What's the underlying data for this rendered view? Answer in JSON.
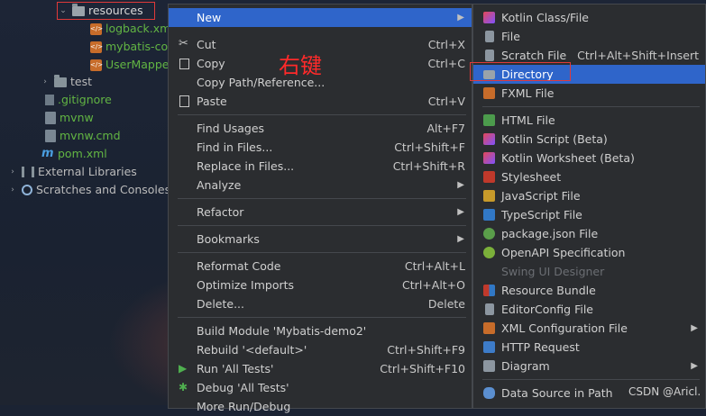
{
  "tree": {
    "items": [
      {
        "label": "resources",
        "kind": "folder-res",
        "arrow": "⌄",
        "color": "#d0d0d0"
      },
      {
        "label": "logback.xm",
        "kind": "xml",
        "color": "#62b543"
      },
      {
        "label": "mybatis-cor",
        "kind": "xml",
        "color": "#62b543"
      },
      {
        "label": "UserMappe",
        "kind": "xml",
        "color": "#62b543"
      },
      {
        "label": "test",
        "kind": "folder",
        "arrow": "›",
        "color": "#bbbbbb"
      },
      {
        "label": ".gitignore",
        "kind": "git",
        "color": "#62b543"
      },
      {
        "label": "mvnw",
        "kind": "file",
        "color": "#62b543"
      },
      {
        "label": "mvnw.cmd",
        "kind": "file",
        "color": "#62b543"
      },
      {
        "label": "pom.xml",
        "kind": "mvn",
        "color": "#62b543"
      },
      {
        "label": "External Libraries",
        "kind": "lib",
        "arrow": "›",
        "color": "#bbbbbb"
      },
      {
        "label": "Scratches and Consoles",
        "kind": "scr",
        "arrow": "›",
        "color": "#bbbbbb"
      }
    ]
  },
  "annotation": "右键",
  "main_menu": {
    "new": "New",
    "cut": "Cut",
    "cut_sc": "Ctrl+X",
    "copy": "Copy",
    "copy_sc": "Ctrl+C",
    "copy_path": "Copy Path/Reference...",
    "paste": "Paste",
    "paste_sc": "Ctrl+V",
    "find_usages": "Find Usages",
    "find_usages_sc": "Alt+F7",
    "find_in_files": "Find in Files...",
    "find_in_files_sc": "Ctrl+Shift+F",
    "replace_in_files": "Replace in Files...",
    "replace_in_files_sc": "Ctrl+Shift+R",
    "analyze": "Analyze",
    "refactor": "Refactor",
    "bookmarks": "Bookmarks",
    "reformat": "Reformat Code",
    "reformat_sc": "Ctrl+Alt+L",
    "optimize": "Optimize Imports",
    "optimize_sc": "Ctrl+Alt+O",
    "delete": "Delete...",
    "delete_sc": "Delete",
    "build_module": "Build Module 'Mybatis-demo2'",
    "rebuild": "Rebuild '<default>'",
    "rebuild_sc": "Ctrl+Shift+F9",
    "run_tests": "Run 'All Tests'",
    "run_tests_sc": "Ctrl+Shift+F10",
    "debug_tests": "Debug 'All Tests'",
    "more_run": "More Run/Debug"
  },
  "sub_menu": {
    "kotlin_class": "Kotlin Class/File",
    "file": "File",
    "scratch_file": "Scratch File",
    "scratch_file_sc": "Ctrl+Alt+Shift+Insert",
    "directory": "Directory",
    "fxml": "FXML File",
    "html": "HTML File",
    "kotlin_script": "Kotlin Script (Beta)",
    "kotlin_worksheet": "Kotlin Worksheet (Beta)",
    "stylesheet": "Stylesheet",
    "javascript": "JavaScript File",
    "typescript": "TypeScript File",
    "package_json": "package.json File",
    "openapi": "OpenAPI Specification",
    "swing": "Swing UI Designer",
    "resource_bundle": "Resource Bundle",
    "editorconfig": "EditorConfig File",
    "xml_config": "XML Configuration File",
    "http_request": "HTTP Request",
    "diagram": "Diagram",
    "data_source": "Data Source in Path"
  },
  "watermark": "CSDN @Aricl.",
  "colors": {
    "menu_bg": "#2b2d30",
    "highlight": "#2f65ca",
    "annotation": "#ff2a2a",
    "file_green": "#62b543"
  }
}
